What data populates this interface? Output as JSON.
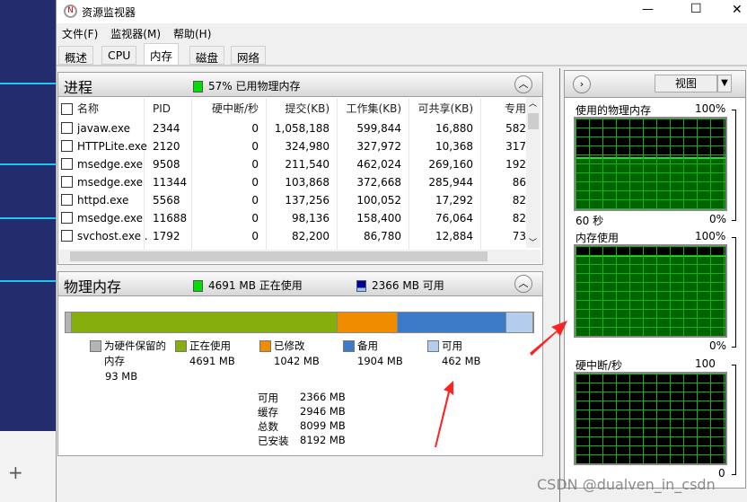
{
  "window": {
    "title": "资源监视器",
    "minimize": "—",
    "maximize": "☐",
    "close": "✕"
  },
  "menu": [
    "文件(F)",
    "监视器(M)",
    "帮助(H)"
  ],
  "tabs": [
    {
      "label": "概述"
    },
    {
      "label": "CPU"
    },
    {
      "label": "内存",
      "active": true
    },
    {
      "label": "磁盘"
    },
    {
      "label": "网络"
    }
  ],
  "processes": {
    "title": "进程",
    "status": "57% 已用物理内存",
    "status_color": "#00e000",
    "columns": [
      "名称",
      "PID",
      "硬中断/秒",
      "提交(KB)",
      "工作集(KB)",
      "可共享(KB)",
      "专用"
    ],
    "rows": [
      [
        "javaw.exe",
        "2344",
        "0",
        "1,058,188",
        "599,844",
        "16,880",
        "582"
      ],
      [
        "HTTPLite.exe",
        "2120",
        "0",
        "324,980",
        "327,972",
        "10,368",
        "317"
      ],
      [
        "msedge.exe",
        "9508",
        "0",
        "211,540",
        "462,024",
        "269,160",
        "192"
      ],
      [
        "msedge.exe",
        "11344",
        "0",
        "103,868",
        "372,668",
        "285,944",
        "86"
      ],
      [
        "httpd.exe",
        "5568",
        "0",
        "137,256",
        "100,052",
        "17,292",
        "82"
      ],
      [
        "msedge.exe",
        "11688",
        "0",
        "98,136",
        "158,400",
        "76,064",
        "82"
      ],
      [
        "svchost.exe ...",
        "1792",
        "0",
        "82,200",
        "86,780",
        "12,884",
        "73"
      ]
    ]
  },
  "physical_memory": {
    "title": "物理内存",
    "in_use_status": "4691 MB 正在使用",
    "available_status": "2366 MB 可用",
    "segments": [
      {
        "label": "为硬件保留的内存",
        "value": "93 MB",
        "mb": 93,
        "color": "#b4b4b4"
      },
      {
        "label": "正在使用",
        "value": "4691 MB",
        "mb": 4691,
        "color": "#86ae0c"
      },
      {
        "label": "已修改",
        "value": "1042 MB",
        "mb": 1042,
        "color": "#f08c00"
      },
      {
        "label": "备用",
        "value": "1904 MB",
        "mb": 1904,
        "color": "#3c7bc8"
      },
      {
        "label": "可用",
        "value": "462 MB",
        "mb": 462,
        "color": "#b4cdee"
      }
    ],
    "summary": [
      [
        "可用",
        "2366 MB"
      ],
      [
        "缓存",
        "2946 MB"
      ],
      [
        "总数",
        "8099 MB"
      ],
      [
        "已安装",
        "8192 MB"
      ]
    ]
  },
  "side": {
    "view_label": "视图",
    "graphs": [
      {
        "title": "使用的物理内存",
        "max": "100%",
        "min": "0%",
        "time": "60 秒",
        "fill_percent": 57
      },
      {
        "title": "内存使用",
        "max": "100%",
        "min": "0%",
        "fill_percent": 90
      },
      {
        "title": "硬中断/秒",
        "max": "100",
        "min": "0",
        "fill_percent": 0
      }
    ]
  },
  "watermark": "CSDN @dualven_in_csdn"
}
